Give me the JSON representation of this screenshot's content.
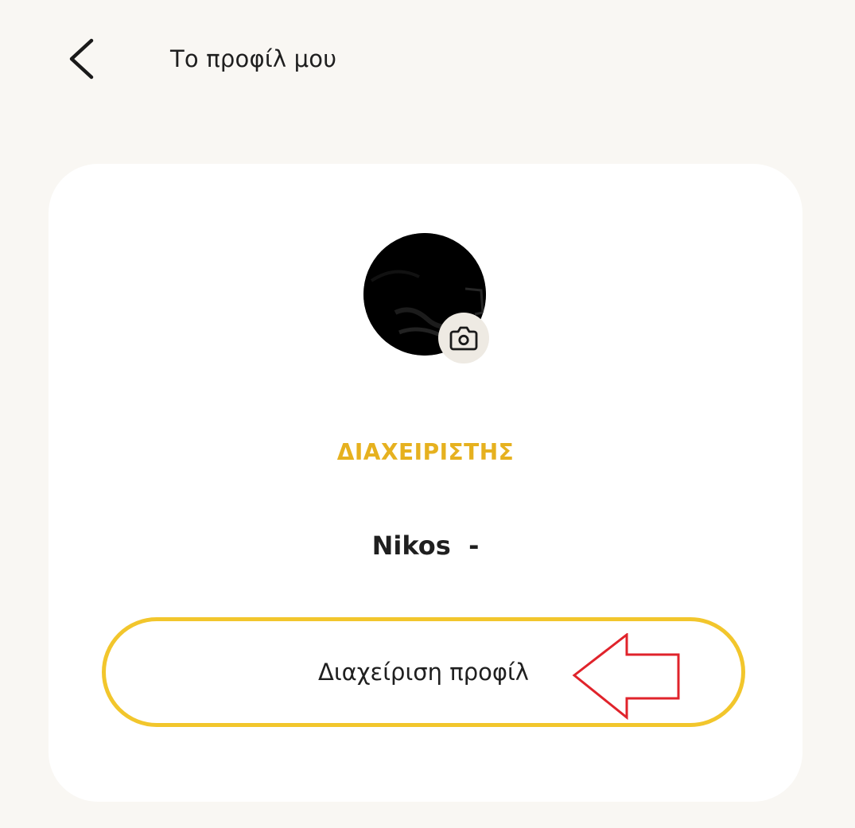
{
  "header": {
    "back_icon": "chevron-left-icon",
    "title": "Το προφίλ μου"
  },
  "profile": {
    "avatar": "user-avatar",
    "camera_icon": "camera-icon",
    "role": "ΔΙΑΧΕΙΡΙΣΤΗΣ",
    "name": "Nikos  -"
  },
  "actions": {
    "manage_profile_label": "Διαχείριση προφίλ"
  },
  "colors": {
    "background": "#f9f7f3",
    "card": "#ffffff",
    "accent_yellow": "#f2c62c",
    "role_text": "#e6b11f",
    "annotation_arrow": "#e0232b",
    "text": "#1f1f1f"
  }
}
